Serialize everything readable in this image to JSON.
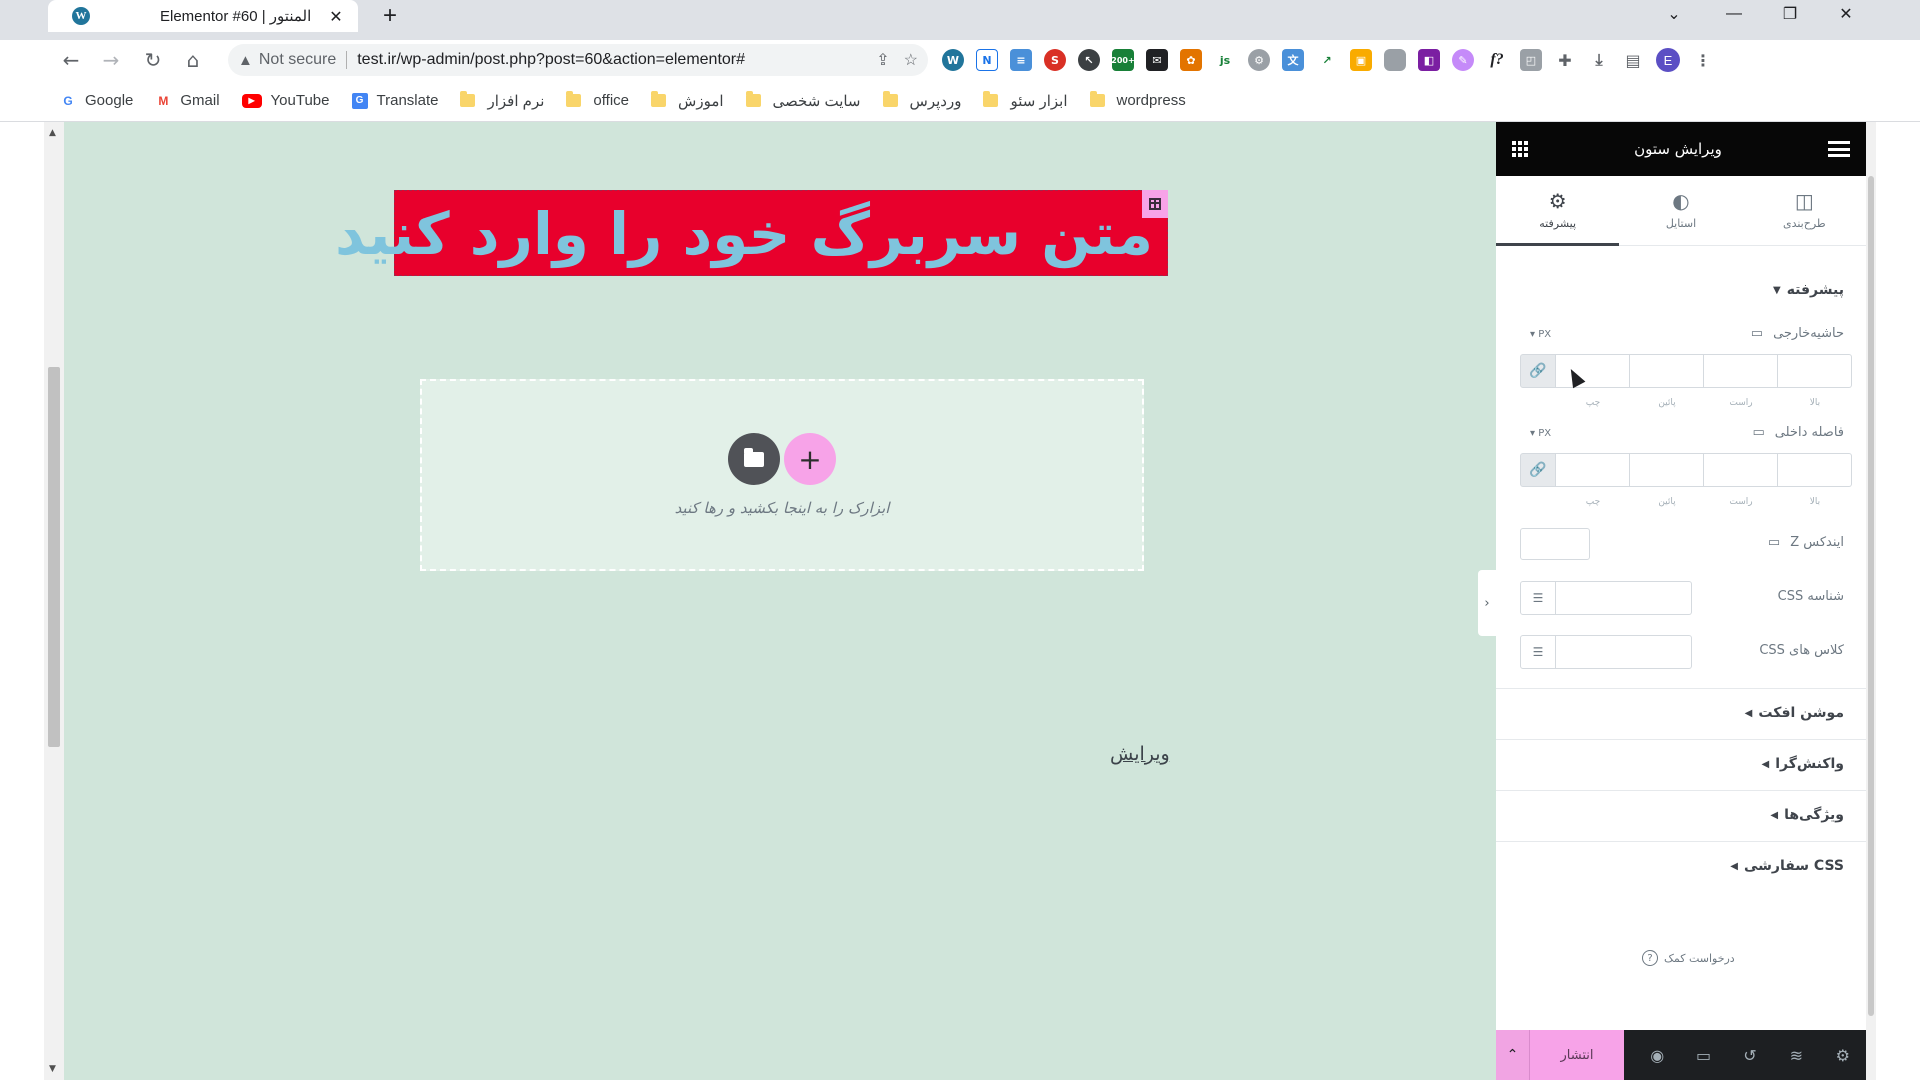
{
  "browser": {
    "tab_title": "Elementor #60 | المنتور",
    "tab_close": "✕",
    "new_tab": "+",
    "minimize": "—",
    "restore": "❐",
    "close": "✕",
    "tab_overflow": "⌄",
    "security_label": "Not secure",
    "url": "test.ir/wp-admin/post.php?post=60&action=elementor#",
    "avatar_letter": "E",
    "badge_count": "200+"
  },
  "bookmarks": [
    {
      "label": "Google",
      "icon": "G",
      "color": "#4285f4"
    },
    {
      "label": "Gmail",
      "icon": "M",
      "color": "#ea4335"
    },
    {
      "label": "YouTube",
      "icon": "▶",
      "color": "#ff0000"
    },
    {
      "label": "Translate",
      "icon": "G",
      "color": "#4285f4"
    },
    {
      "label": "نرم افزار",
      "icon": "folder"
    },
    {
      "label": "office",
      "icon": "folder"
    },
    {
      "label": "اموزش",
      "icon": "folder"
    },
    {
      "label": "سایت شخصی",
      "icon": "folder"
    },
    {
      "label": "وردپرس",
      "icon": "folder"
    },
    {
      "label": "ابزار سئو",
      "icon": "folder"
    },
    {
      "label": "wordpress",
      "icon": "folder"
    }
  ],
  "canvas": {
    "heading": "متن سربرگ خود را وارد کنید",
    "drop_hint": "ابزارک را به اینجا بکشید و رها کنید",
    "edit_link": "ویرایش",
    "bg_color": "#d0e5da",
    "heading_bg": "#e8002c",
    "heading_color": "#7fc4dd"
  },
  "panel": {
    "title": "ویرایش ستون",
    "tabs": [
      {
        "label": "طرح‌بندی",
        "icon": "layout-icon"
      },
      {
        "label": "استایل",
        "icon": "style-icon"
      },
      {
        "label": "پیشرفته",
        "icon": "gear-icon",
        "active": true
      }
    ],
    "section_advanced": "پیشرفته",
    "margin_label": "حاشیه‌خارجی",
    "padding_label": "فاصله داخلی",
    "unit": "PX",
    "dim_labels": [
      "بالا",
      "راست",
      "پائین",
      "چپ"
    ],
    "zindex_label": "ایندکس Z",
    "css_id_label": "شناسه CSS",
    "css_classes_label": "کلاس های CSS",
    "accordions": [
      "موشن افکت",
      "واکنش‌گرا",
      "ویژگی‌ها",
      "CSS سفارشی"
    ],
    "help": "درخواست کمک",
    "publish": "انتشار"
  }
}
